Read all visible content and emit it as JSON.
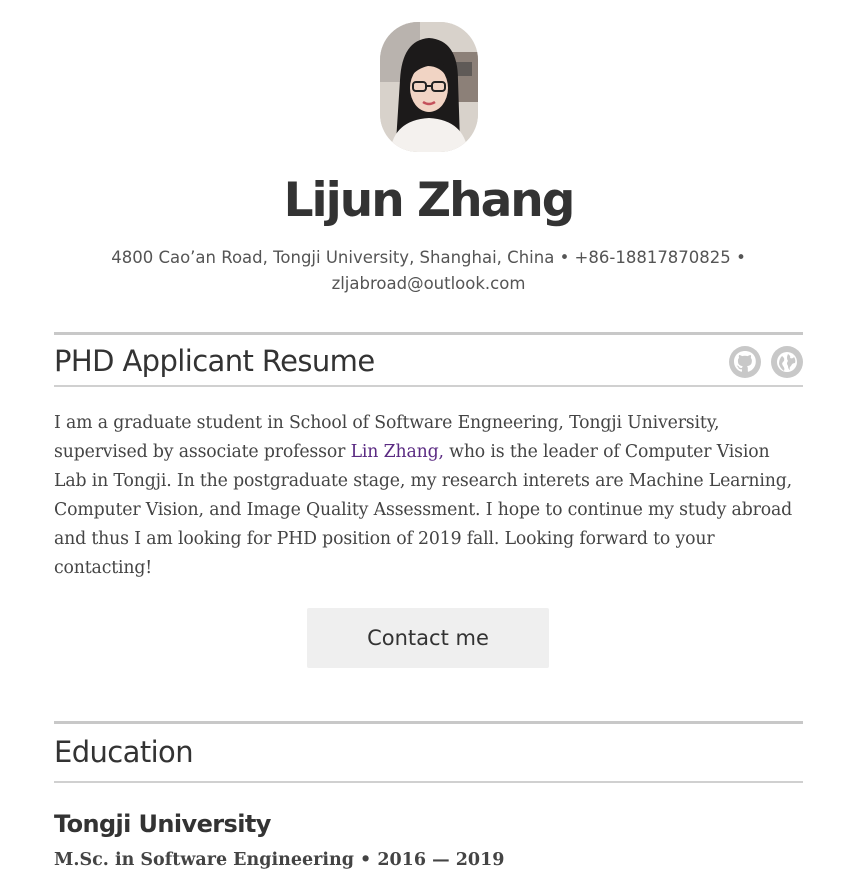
{
  "profile": {
    "name": "Lijun Zhang",
    "address": "4800 Cao’an Road, Tongji University, Shanghai, China",
    "separator": "•",
    "phone": "+86-18817870825",
    "email": "zljabroad@outlook.com"
  },
  "resume": {
    "title": "PHD Applicant Resume",
    "icons": [
      "github-icon",
      "globe-icon"
    ],
    "summary_before_link": "I am a graduate student in School of Software Engneering, Tongji University, supervised by associate professor ",
    "summary_link": "Lin Zhang,",
    "summary_after_link": " who is the leader of Computer Vision Lab in Tongji. In the postgraduate stage, my research interets are Machine Learning, Computer Vision, and Image Quality Assessment. I hope to continue my study abroad and thus I am looking for PHD position of 2019 fall. Looking forward to your contacting!",
    "contact_button": "Contact me"
  },
  "education": {
    "title": "Education",
    "entries": [
      {
        "school": "Tongji University",
        "degree": "M.Sc. in Software Engineering",
        "separator": "•",
        "years": "2016 — 2019"
      }
    ]
  },
  "colors": {
    "text": "#333333",
    "link": "#5a2a82",
    "rule": "#c8c8c8",
    "button_bg": "#efefef"
  }
}
